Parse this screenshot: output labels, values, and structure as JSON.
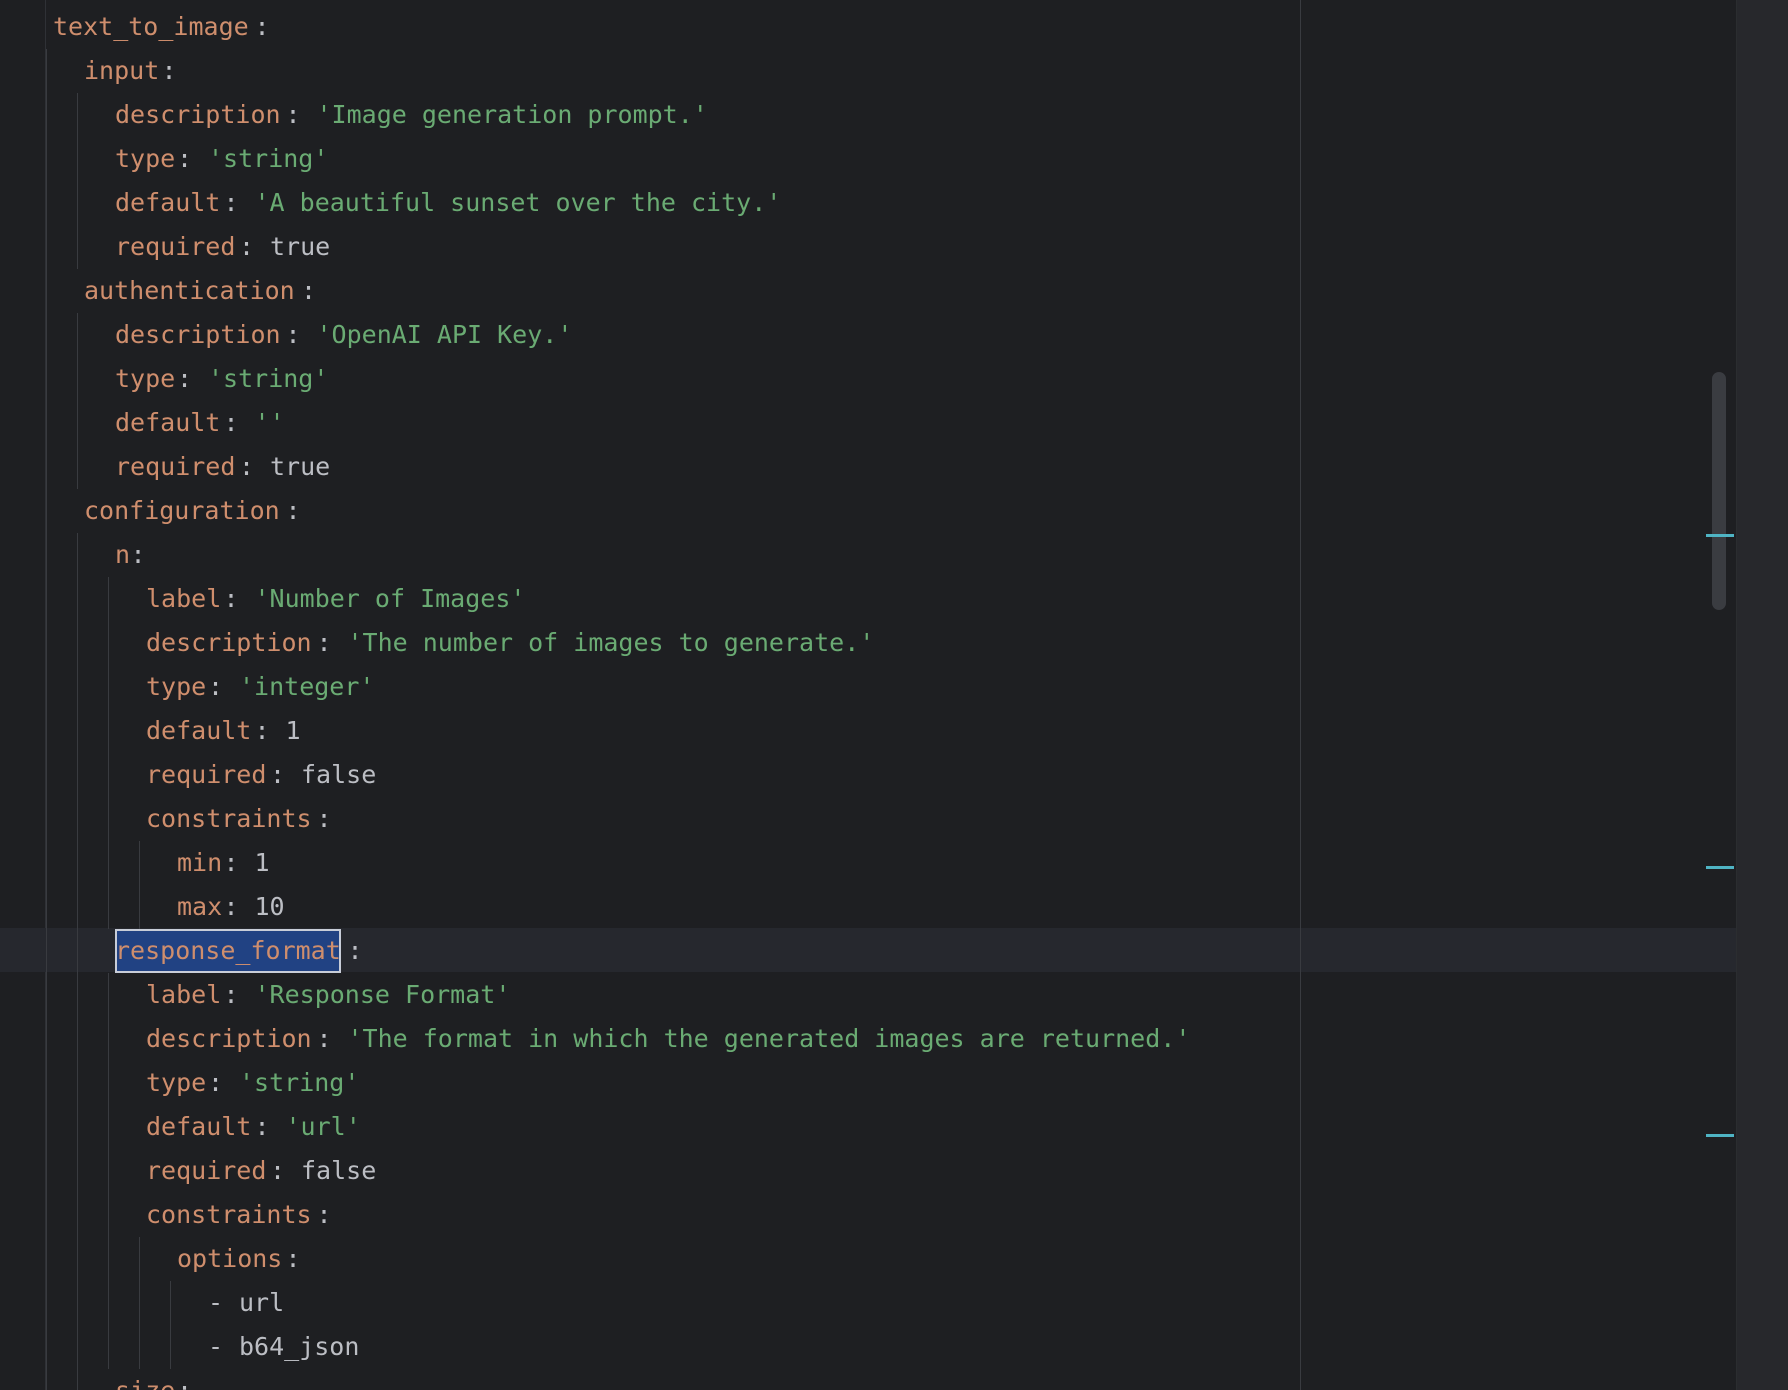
{
  "editor": {
    "language": "yaml",
    "current_line": 21,
    "selected_text": "response_format",
    "lines": [
      {
        "indent": 0,
        "key": "text_to_image",
        "sep": ":"
      },
      {
        "indent": 1,
        "key": "input",
        "sep": ":"
      },
      {
        "indent": 2,
        "key": "description",
        "sep": ": ",
        "value": "'Image generation prompt.'",
        "vtype": "str"
      },
      {
        "indent": 2,
        "key": "type",
        "sep": ": ",
        "value": "'string'",
        "vtype": "str"
      },
      {
        "indent": 2,
        "key": "default",
        "sep": ": ",
        "value": "'A beautiful sunset over the city.'",
        "vtype": "str"
      },
      {
        "indent": 2,
        "key": "required",
        "sep": ": ",
        "value": "true",
        "vtype": "kw"
      },
      {
        "indent": 1,
        "key": "authentication",
        "sep": ":"
      },
      {
        "indent": 2,
        "key": "description",
        "sep": ": ",
        "value": "'OpenAI API Key.'",
        "vtype": "str"
      },
      {
        "indent": 2,
        "key": "type",
        "sep": ": ",
        "value": "'string'",
        "vtype": "str"
      },
      {
        "indent": 2,
        "key": "default",
        "sep": ": ",
        "value": "''",
        "vtype": "str"
      },
      {
        "indent": 2,
        "key": "required",
        "sep": ": ",
        "value": "true",
        "vtype": "kw"
      },
      {
        "indent": 1,
        "key": "configuration",
        "sep": ":"
      },
      {
        "indent": 2,
        "key": "n",
        "sep": ":"
      },
      {
        "indent": 3,
        "key": "label",
        "sep": ": ",
        "value": "'Number of Images'",
        "vtype": "str"
      },
      {
        "indent": 3,
        "key": "description",
        "sep": ": ",
        "value": "'The number of images to generate.'",
        "vtype": "str"
      },
      {
        "indent": 3,
        "key": "type",
        "sep": ": ",
        "value": "'integer'",
        "vtype": "str"
      },
      {
        "indent": 3,
        "key": "default",
        "sep": ": ",
        "value": "1",
        "vtype": "num"
      },
      {
        "indent": 3,
        "key": "required",
        "sep": ": ",
        "value": "false",
        "vtype": "kw"
      },
      {
        "indent": 3,
        "key": "constraints",
        "sep": ":"
      },
      {
        "indent": 4,
        "key": "min",
        "sep": ": ",
        "value": "1",
        "vtype": "num"
      },
      {
        "indent": 4,
        "key": "max",
        "sep": ": ",
        "value": "10",
        "vtype": "num"
      },
      {
        "indent": 2,
        "key": "response_format",
        "sep": ":",
        "selected": true
      },
      {
        "indent": 3,
        "key": "label",
        "sep": ": ",
        "value": "'Response Format'",
        "vtype": "str"
      },
      {
        "indent": 3,
        "key": "description",
        "sep": ": ",
        "value": "'The format in which the generated images are returned.'",
        "vtype": "str"
      },
      {
        "indent": 3,
        "key": "type",
        "sep": ": ",
        "value": "'string'",
        "vtype": "str"
      },
      {
        "indent": 3,
        "key": "default",
        "sep": ": ",
        "value": "'url'",
        "vtype": "str"
      },
      {
        "indent": 3,
        "key": "required",
        "sep": ": ",
        "value": "false",
        "vtype": "kw"
      },
      {
        "indent": 3,
        "key": "constraints",
        "sep": ":"
      },
      {
        "indent": 4,
        "key": "options",
        "sep": ":"
      },
      {
        "indent": 5,
        "dash": "- ",
        "value": "url",
        "vtype": "kw"
      },
      {
        "indent": 5,
        "dash": "- ",
        "value": "b64_json",
        "vtype": "kw"
      },
      {
        "indent": 2,
        "key": "size",
        "sep": ":"
      }
    ]
  },
  "colors": {
    "background": "#1e1f22",
    "key": "#cf8e6d",
    "string": "#6aab73",
    "plain": "#bcbec4",
    "selection": "#214283",
    "marker": "#4fb4c4"
  }
}
